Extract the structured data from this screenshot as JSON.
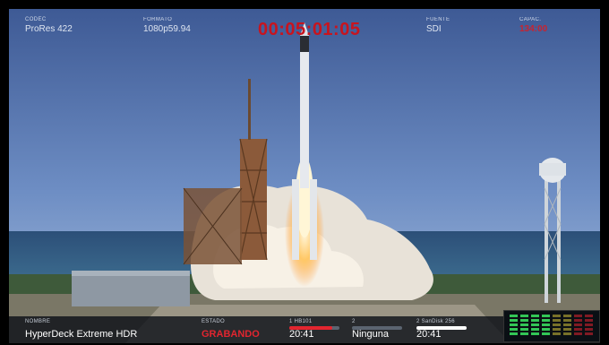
{
  "top_bar": {
    "codec": {
      "label": "CÓDEC",
      "value": "ProRes 422"
    },
    "format": {
      "label": "FORMATO",
      "value": "1080p59.94"
    },
    "timecode": "00:05:01:05",
    "source": {
      "label": "FUENTE",
      "value": "SDI"
    },
    "card": {
      "label": "CAPAC.",
      "value": "134:00"
    }
  },
  "bottom_bar": {
    "name": {
      "label": "NOMBRE",
      "value": "HyperDeck Extreme HDR"
    },
    "status": {
      "label": "ESTADO",
      "value": "GRABANDO"
    },
    "slots": [
      {
        "label": "1  HB101",
        "value": "20:41",
        "fill": 0.85,
        "color": "#e2252f"
      },
      {
        "label": "2",
        "value": "Ninguna",
        "fill": 0,
        "color": "#7a828c"
      },
      {
        "label": "2  SanDisk 256",
        "value": "20:41",
        "fill": 1.0,
        "color": "#ffffff"
      }
    ]
  },
  "audio_meters": {
    "channels": 8,
    "colors": {
      "low": "#36d15a",
      "mid": "#d3c23a",
      "high": "#e2252f"
    }
  },
  "colors": {
    "accent_red": "#c8141e"
  }
}
